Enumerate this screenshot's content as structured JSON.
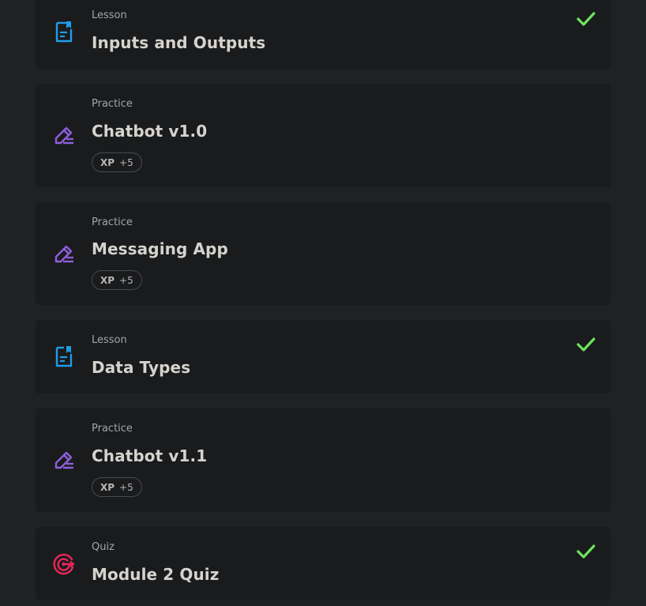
{
  "items": [
    {
      "type": "Lesson",
      "title": "Inputs and Outputs",
      "icon": "lesson-icon",
      "completed": true
    },
    {
      "type": "Practice",
      "title": "Chatbot v1.0",
      "icon": "practice-icon",
      "xp_label": "XP",
      "xp_value": "+5",
      "completed": false
    },
    {
      "type": "Practice",
      "title": "Messaging App",
      "icon": "practice-icon",
      "xp_label": "XP",
      "xp_value": "+5",
      "completed": false
    },
    {
      "type": "Lesson",
      "title": "Data Types",
      "icon": "lesson-icon",
      "completed": true
    },
    {
      "type": "Practice",
      "title": "Chatbot v1.1",
      "icon": "practice-icon",
      "xp_label": "XP",
      "xp_value": "+5",
      "completed": false
    },
    {
      "type": "Quiz",
      "title": "Module 2 Quiz",
      "icon": "quiz-target-icon",
      "completed": true
    }
  ],
  "colors": {
    "background": "#202123",
    "card": "#1a1b1d",
    "lesson_icon": "#1f9ce8",
    "practice_icon": "#8e5fdc",
    "quiz_icon": "#e8275a",
    "check": "#6fe35f"
  }
}
